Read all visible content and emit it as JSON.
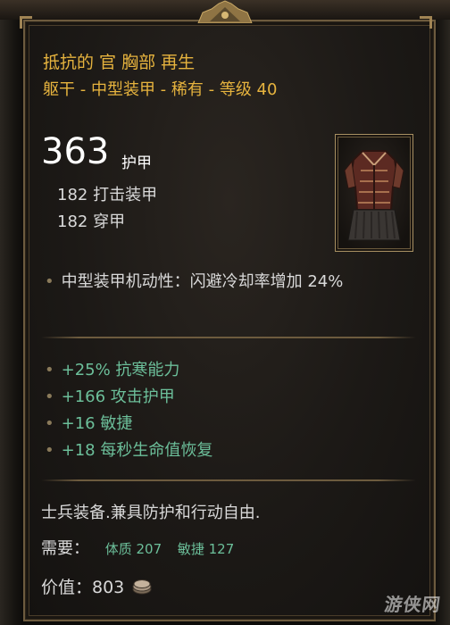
{
  "item": {
    "name": "抵抗的 官 胸部 再生",
    "subtitle": "躯干 - 中型装甲 - 稀有 - 等级 40",
    "armor_total": "363",
    "armor_label": "护甲",
    "sub_stats": [
      "182 打击装甲",
      "182 穿甲"
    ],
    "mobility": "中型装甲机动性：闪避冷却率增加 24%",
    "affixes": [
      "+25% 抗寒能力",
      "+166 攻击护甲",
      "+16 敏捷",
      "+18 每秒生命值恢复"
    ],
    "flavor": "士兵装备.兼具防护和行动自由.",
    "requirements_label": "需要：",
    "requirements": [
      "体质 207",
      "敏捷 127"
    ],
    "value_label": "价值：803",
    "icon": "chest-armor-icon",
    "coin_icon": "coin-icon"
  },
  "watermark": "游侠网",
  "colors": {
    "title": "#e6b33e",
    "affix": "#6cbf9a",
    "text": "#d9d9d9",
    "frame": "#6d5b3e"
  }
}
